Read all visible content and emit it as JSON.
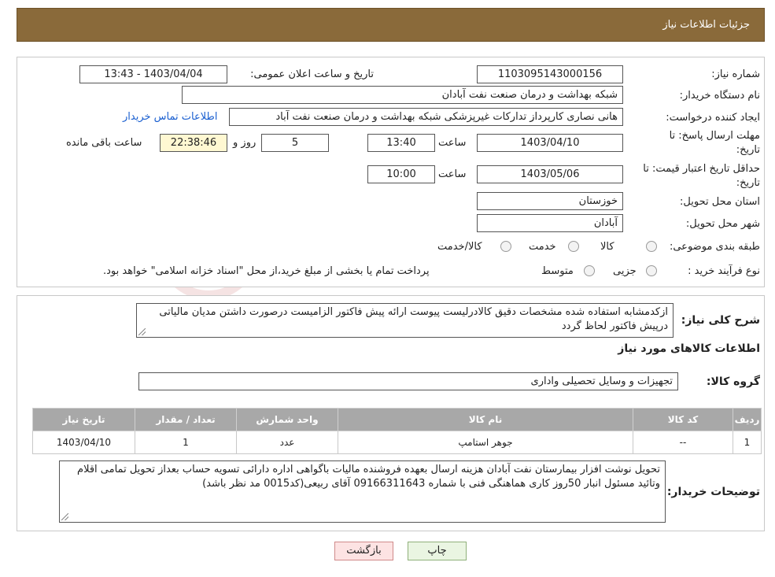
{
  "header": {
    "title": "جزئیات اطلاعات نیاز"
  },
  "details": {
    "need_number_label": "شماره نیاز:",
    "need_number": "1103095143000156",
    "announce_label": "تاریخ و ساعت اعلان عمومی:",
    "announce_value": "1403/04/04 - 13:43",
    "buyer_org_label": "نام دستگاه خریدار:",
    "buyer_org": "شبکه بهداشت و درمان صنعت نفت آبادان",
    "creator_label": "ایجاد کننده درخواست:",
    "creator": "هانی نصاری کارپرداز تدارکات غیرپزشکی شبکه بهداشت و درمان صنعت نفت آباد",
    "contact_link": "اطلاعات تماس خریدار",
    "reply_deadline_label_1": "مهلت ارسال پاسخ: تا",
    "reply_deadline_label_2": "تاریخ:",
    "reply_date": "1403/04/10",
    "time_label": "ساعت",
    "reply_time": "13:40",
    "days_value": "5",
    "days_label": "روز و",
    "remaining_time": "22:38:46",
    "remaining_label": "ساعت باقی مانده",
    "validity_label_1": "حداقل تاریخ اعتبار قیمت: تا",
    "validity_label_2": "تاریخ:",
    "validity_date": "1403/05/06",
    "validity_time": "10:00",
    "province_label": "استان محل تحویل:",
    "province": "خوزستان",
    "city_label": "شهر محل تحویل:",
    "city": "آبادان",
    "category_label": "طبقه بندی موضوعی:",
    "category_options": [
      "کالا",
      "خدمت",
      "کالا/خدمت"
    ],
    "purchase_type_label": "نوع فرآیند خرید :",
    "purchase_options": [
      "جزیی",
      "متوسط"
    ],
    "purchase_note": "پرداخت تمام یا بخشی از مبلغ خرید،از محل \"اسناد خزانه اسلامی\" خواهد بود."
  },
  "general": {
    "description_label": "شرح کلی نیاز:",
    "description": "ازکدمشابه استفاده شده مشخصات دقیق کالادرلیست پیوست ارائه پیش فاکتور الزامیست درصورت داشتن مدیان مالیاتی درپیش فاکتور لحاظ گردد",
    "goods_info_title": "اطلاعات کالاهای مورد نیاز",
    "goods_group_label": "گروه کالا:",
    "goods_group": "تجهیزات و وسایل تحصیلی واداری"
  },
  "table": {
    "headers": [
      "ردیف",
      "کد کالا",
      "نام کالا",
      "واحد شمارش",
      "تعداد / مقدار",
      "تاریخ نیاز"
    ],
    "rows": [
      [
        "1",
        "--",
        "جوهر استامپ",
        "عدد",
        "1",
        "1403/04/10"
      ]
    ]
  },
  "buyer_notes": {
    "label": "توضیحات خریدار:",
    "text": "تحویل نوشت افزار بیمارستان نفت آبادان هزینه ارسال بعهده فروشنده مالیات باگواهی اداره دارائی تسویه حساب بعداز تحویل تمامی اقلام وتائید مسئول انبار 50روز کاری هماهنگی فنی با شماره 09166311643 آقای ربیعی(کد0015 مد نظر باشد)"
  },
  "buttons": {
    "print": "چاپ",
    "return": "بازگشت"
  }
}
